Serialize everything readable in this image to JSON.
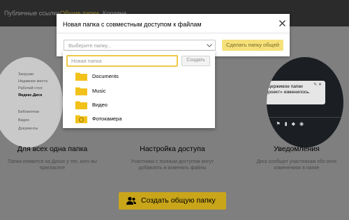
{
  "topbar": {
    "tabs": [
      "Публичные ссылки",
      "Общие папки",
      "Корзина"
    ]
  },
  "illustration_left": {
    "items": [
      "Загрузки",
      "Недавние места",
      "Рабочий стол",
      "Яндекс.Диск",
      "Библиотеки",
      "Видео",
      "Документы"
    ]
  },
  "illustration_right": {
    "notification_text": "Содержимое папки «Проект» изменилось."
  },
  "features": [
    {
      "title": "Для всех одна папка",
      "desc": "Папка появится на Диске у тех, кого вы пригласите"
    },
    {
      "title": "Настройка доступа",
      "desc": "Участники с полным доступом могут добавлять и изменять файлы"
    },
    {
      "title": "Уведомления",
      "desc": "Диск сообщит участникам обо всех изменениях в папке"
    }
  ],
  "share_button": {
    "label": "Создать общую папку"
  },
  "dialog": {
    "title": "Новая папка с совместным доступом к файлам",
    "select_placeholder": "Выберите папку...",
    "create_share_label": "Сделать папку общей"
  },
  "dropdown": {
    "new_folder_placeholder": "Новая папка",
    "create_label": "Создать",
    "folders": [
      {
        "label": "Documents",
        "icon": "folder-icon"
      },
      {
        "label": "Music",
        "icon": "folder-icon"
      },
      {
        "label": "Видео",
        "icon": "folder-icon"
      },
      {
        "label": "Фотокамера",
        "icon": "camera-folder-icon"
      }
    ]
  },
  "colors": {
    "accent_yellow": "#f0c84a",
    "button_yellow": "#c9a51a",
    "overlay_gray": "#7f7f7f",
    "topbar": "#2b2b2b"
  }
}
